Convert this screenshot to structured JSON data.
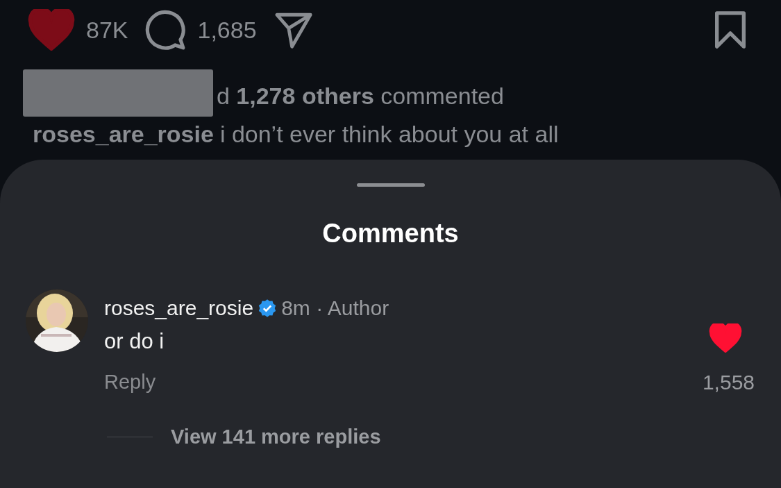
{
  "post_actions": {
    "liked": true,
    "likes": "87K",
    "comments": "1,685"
  },
  "comment_summary": {
    "redacted": true,
    "text": "d **1,278 others** commented"
  },
  "caption": {
    "username": "roses_are_rosie",
    "text": "i don’t ever think about you at all"
  },
  "sheet": {
    "title": "Comments"
  },
  "comments": [
    {
      "username": "roses_are_rosie",
      "verified": true,
      "meta": "8m · Author",
      "text": "or do i",
      "reply": "Reply",
      "liked": true,
      "likes": "1,558",
      "more_replies": "View 141 more replies"
    }
  ]
}
